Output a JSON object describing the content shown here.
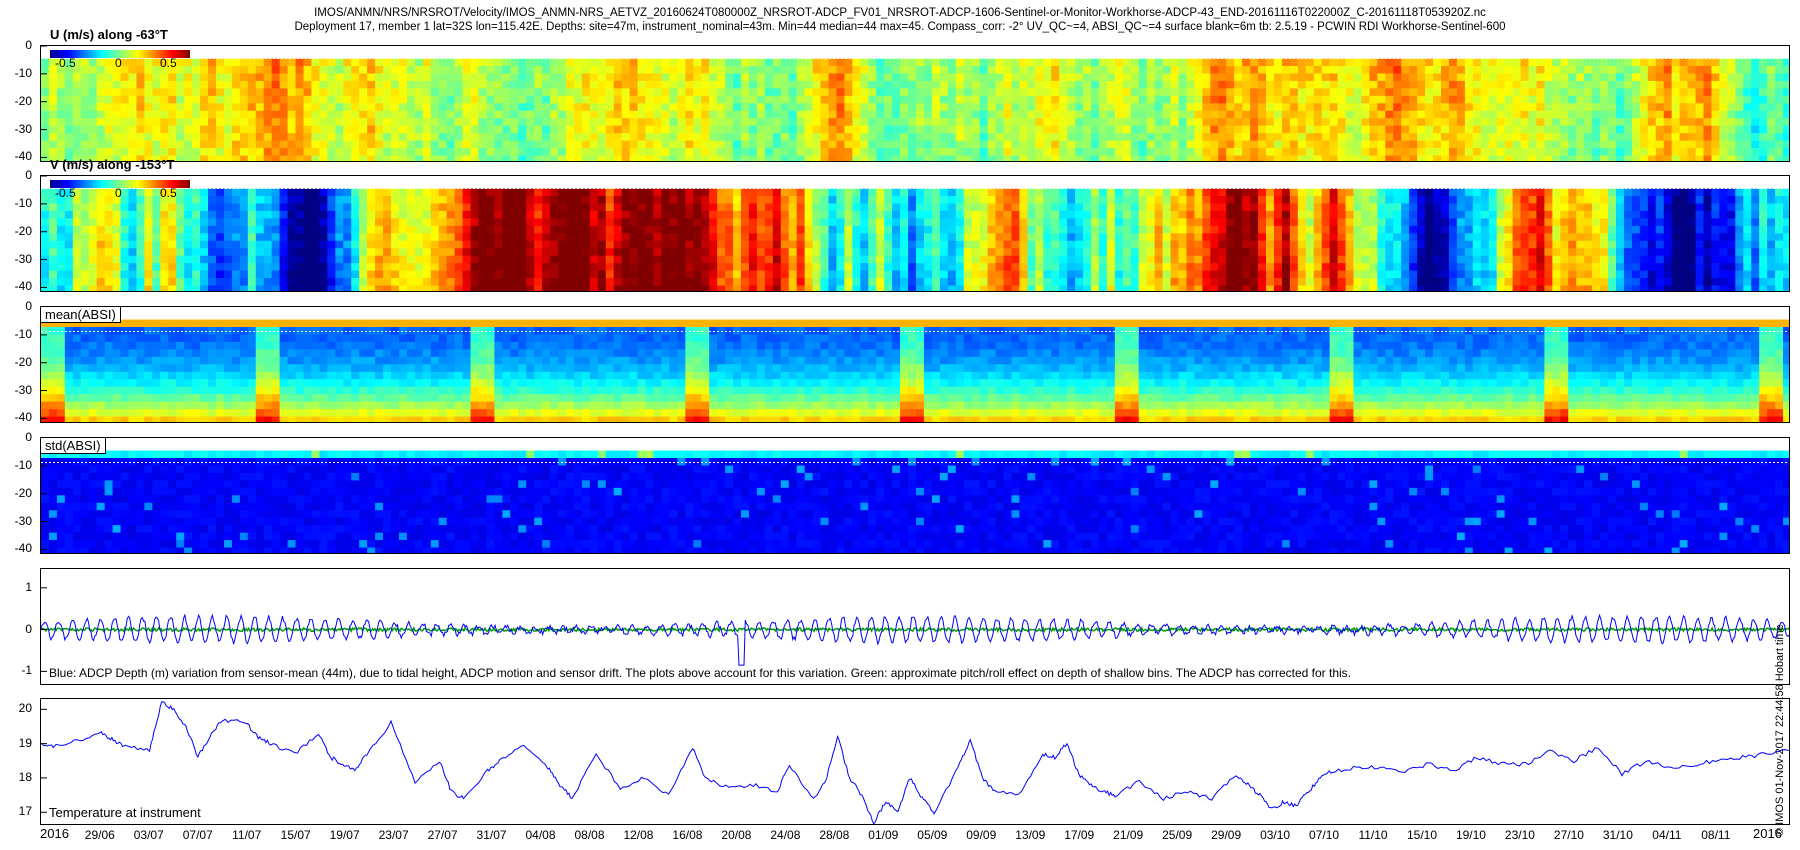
{
  "header": {
    "line1": "IMOS/ANMN/NRS/NRSROT/Velocity/IMOS_ANMN-NRS_AETVZ_20160624T080000Z_NRSROT-ADCP_FV01_NRSROT-ADCP-1606-Sentinel-or-Monitor-Workhorse-ADCP-43_END-20161116T022000Z_C-20161118T053920Z.nc",
    "line2": "Deployment 17, member 1 lat=32S lon=115.42E. Depths: site=47m, instrument_nominal=43m. Min=44 median=44 max=45. Compass_corr: -2° UV_QC~=4, ABSI_QC~=4 surface blank=6m tb: 2.5.19 - PCWIN RDI Workhorse-Sentinel-600"
  },
  "side_note": "© IMOS 01-Nov-2017 22:44:58 Hobart time",
  "colors": {
    "line_blue": "#0000ff",
    "line_green": "#00a000",
    "dashed": "#ffffff"
  },
  "chart_data": [
    {
      "type": "heatmap",
      "title": "U (m/s) along -63°T",
      "colorbar": {
        "min": -0.7,
        "max": 0.7,
        "ticks": [
          "-0.5",
          "0",
          "0.5"
        ]
      },
      "yticks": [
        "0",
        "-10",
        "-20",
        "-30",
        "-40"
      ],
      "ylim": [
        -42,
        0
      ],
      "colormap": "jet",
      "surface_blank_depth": -6
    },
    {
      "type": "heatmap",
      "title": "V (m/s) along -153°T",
      "colorbar": {
        "min": -0.7,
        "max": 0.7,
        "ticks": [
          "-0.5",
          "0",
          "0.5"
        ]
      },
      "yticks": [
        "0",
        "-10",
        "-20",
        "-30",
        "-40"
      ],
      "ylim": [
        -42,
        0
      ],
      "colormap": "jet",
      "surface_blank_depth": -6
    },
    {
      "type": "heatmap",
      "title": "mean(ABSI)",
      "yticks": [
        "0",
        "-10",
        "-20",
        "-30",
        "-40"
      ],
      "ylim": [
        -42,
        0
      ],
      "colormap": "jet"
    },
    {
      "type": "heatmap",
      "title": "std(ABSI)",
      "yticks": [
        "0",
        "-10",
        "-20",
        "-30",
        "-40"
      ],
      "ylim": [
        -42,
        0
      ],
      "colormap": "jet"
    },
    {
      "type": "line",
      "caption": "Blue: ADCP Depth (m) variation from sensor-mean (44m), due to tidal height, ADCP motion and sensor drift. The plots above account for this variation. Green: approximate pitch/roll effect on depth of shallow bins. The ADCP has corrected for this.",
      "yticks": [
        "1",
        "0",
        "-1"
      ],
      "ylim": [
        -1.35,
        1.45
      ],
      "series": [
        {
          "color": "blue",
          "amplitude_typical": 0.3,
          "min": -0.85,
          "max": 0.45
        },
        {
          "color": "green",
          "amplitude_typical": 0.05
        }
      ]
    },
    {
      "type": "line",
      "caption": "Temperature at instrument",
      "yticks": [
        "20",
        "19",
        "18",
        "17"
      ],
      "ylim": [
        16.6,
        20.3
      ],
      "series": [
        {
          "color": "blue",
          "x": [
            0,
            1,
            3,
            5,
            6,
            7,
            9,
            10,
            11,
            12,
            13,
            14,
            15,
            17,
            18,
            19,
            21,
            23,
            24,
            25,
            26,
            27,
            29,
            31,
            33,
            34,
            35,
            37,
            38,
            40,
            42,
            43,
            44,
            46,
            48,
            50,
            52,
            54,
            55,
            57,
            59,
            61,
            62,
            64,
            65,
            66,
            67,
            68,
            69,
            70,
            71,
            72,
            73,
            74,
            76,
            77,
            78,
            79,
            81,
            83,
            84,
            85,
            86,
            87,
            88,
            89,
            91,
            93,
            95,
            97,
            99,
            100,
            101,
            102,
            103,
            104,
            105,
            106,
            107,
            109,
            111,
            113,
            115,
            117,
            119,
            121,
            123,
            125,
            127,
            129,
            131,
            133,
            135,
            137,
            139,
            141,
            143,
            145
          ],
          "y": [
            19.0,
            18.9,
            19.1,
            19.3,
            19.1,
            18.9,
            18.8,
            20.2,
            20.0,
            19.5,
            18.6,
            19.2,
            19.7,
            19.6,
            19.2,
            19.0,
            18.7,
            19.3,
            18.6,
            18.4,
            18.2,
            18.7,
            19.6,
            17.9,
            18.5,
            17.6,
            17.4,
            18.2,
            18.5,
            19.0,
            18.3,
            17.8,
            17.4,
            18.7,
            17.7,
            18.0,
            17.5,
            18.9,
            18.0,
            17.7,
            17.8,
            17.6,
            18.4,
            17.4,
            17.9,
            19.2,
            18.0,
            17.5,
            16.7,
            17.3,
            17.0,
            18.0,
            17.4,
            17.0,
            18.3,
            19.1,
            18.0,
            17.6,
            17.5,
            18.7,
            18.6,
            19.0,
            18.1,
            17.8,
            17.6,
            17.5,
            17.9,
            17.4,
            17.6,
            17.4,
            18.1,
            17.8,
            17.5,
            17.1,
            17.3,
            17.2,
            17.6,
            18.0,
            18.2,
            18.3,
            18.3,
            18.2,
            18.4,
            18.2,
            18.6,
            18.4,
            18.4,
            18.8,
            18.5,
            18.9,
            18.1,
            18.5,
            18.3,
            18.4,
            18.5,
            18.6,
            18.7,
            18.8
          ]
        }
      ]
    }
  ],
  "x_axis": {
    "year_start": "2016",
    "year_end": "2016",
    "ticks": [
      "29/06",
      "03/07",
      "07/07",
      "11/07",
      "15/07",
      "19/07",
      "23/07",
      "27/07",
      "31/07",
      "04/08",
      "08/08",
      "12/08",
      "16/08",
      "20/08",
      "24/08",
      "28/08",
      "01/09",
      "05/09",
      "09/09",
      "13/09",
      "17/09",
      "21/09",
      "25/09",
      "29/09",
      "03/10",
      "07/10",
      "11/10",
      "15/10",
      "19/10",
      "23/10",
      "27/10",
      "31/10",
      "04/11",
      "08/11"
    ]
  }
}
